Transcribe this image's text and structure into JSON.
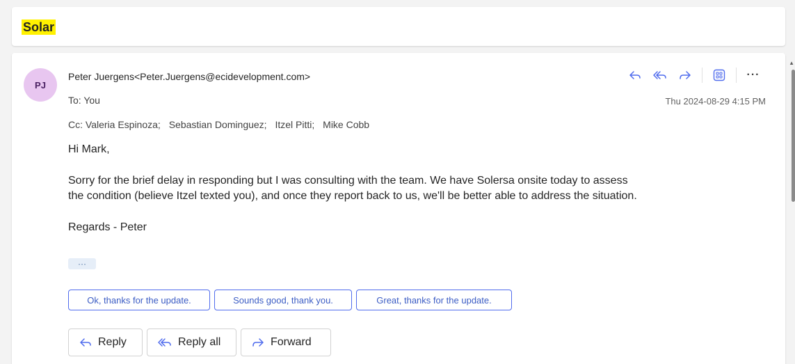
{
  "subject": "Solar",
  "message": {
    "avatar_initials": "PJ",
    "sender": "Peter Juergens<Peter.Juergens@ecidevelopment.com>",
    "to_label": "To:",
    "to_value": "You",
    "cc_label": "Cc:",
    "cc": [
      "Valeria Espinoza;",
      "Sebastian Dominguez;",
      "Itzel Pitti;",
      "Mike Cobb"
    ],
    "timestamp": "Thu 2024-08-29 4:15 PM",
    "greeting": "Hi Mark,",
    "paragraph_line1": "Sorry for the brief delay in responding but I was consulting with the team. We have Solersa onsite today to assess",
    "paragraph_line2": "the condition (believe Itzel texted you), and once they report back to us, we'll be better able to address the situation.",
    "signoff": "Regards - Peter",
    "show_more": "···"
  },
  "suggested_replies": [
    "Ok, thanks for the update.",
    "Sounds good, thank you.",
    "Great, thanks for the update."
  ],
  "reply_buttons": {
    "reply": "Reply",
    "reply_all": "Reply all",
    "forward": "Forward"
  },
  "header_more": "···",
  "colors": {
    "accent": "#4f6bed",
    "highlight": "#fff100",
    "avatar_bg": "#e8c6f0"
  }
}
